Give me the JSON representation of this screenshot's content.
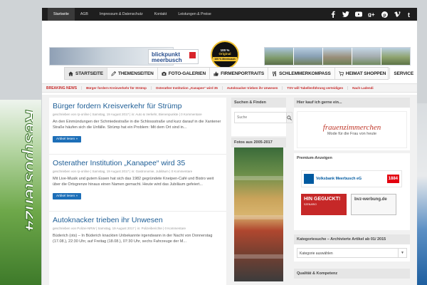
{
  "topnav": [
    {
      "label": "Startseite",
      "active": true
    },
    {
      "label": "AGB",
      "active": false
    },
    {
      "label": "Impressum & Datenschutz",
      "active": false
    },
    {
      "label": "Kontakt",
      "active": false
    },
    {
      "label": "Leistungen & Preise",
      "active": false
    }
  ],
  "social_icons": [
    "facebook-icon",
    "twitter-icon",
    "youtube-icon",
    "googleplus-icon",
    "pinterest-icon",
    "vimeo-icon",
    "tumblr-icon"
  ],
  "header": {
    "logo_line1": "blickpunkt",
    "logo_line2": "meerbusch",
    "seal_top": "100 %",
    "seal_mid": "Original",
    "seal_ribbon": "100 % Meerbusch"
  },
  "mainnav": [
    {
      "label": "Startseite",
      "icon": "home-icon",
      "active": true
    },
    {
      "label": "Themenseiten",
      "icon": "pencil-icon",
      "active": false
    },
    {
      "label": "Foto-Galerien",
      "icon": "camera-icon",
      "active": false
    },
    {
      "label": "Firmenportraits",
      "icon": "thumbs-up-icon",
      "active": false
    },
    {
      "label": "Schlemmerkompass",
      "icon": "cutlery-icon",
      "active": false
    },
    {
      "label": "Heimat shoppen",
      "icon": "cart-icon",
      "active": false
    },
    {
      "label": "Service",
      "icon": "",
      "active": false
    }
  ],
  "breaking": {
    "label": "BREAKING NEWS",
    "items": [
      "Bürger fordern Kreisverkehr für Strümp",
      "Osterather Institution „Kanapee“ wird 35",
      "Autoknacker trieben ihr Unwesen",
      "TSV will Tabellenführung verteidigen",
      "Nach Ladendi"
    ]
  },
  "articles": [
    {
      "title": "Bürger fordern Kreisverkehr für Strümp",
      "meta": "geschrieben von rp-online  |  Samstag, 19 August 2017  |  in: Auto & Verkehr, Bienenpunkte  |  0 Kommentare",
      "excerpt": "An den Einmündungen der Schmiedestraße in die Schlossstraße und kurz darauf in die Xantener Straße häufen sich die Unfälle. Strümp hat ein Problem: Mit dem Ort sind in...",
      "more": "Artikel lesen »"
    },
    {
      "title": "Osterather Institution „Kanapee“ wird 35",
      "meta": "geschrieben von rp-online  |  Samstag, 19 August 2017  |  in: Gastronomie, Jubiläum  |  0 Kommentare",
      "excerpt": "Mit Live-Musik und gutem Essen hat sich das 1982 gegründete Kneipen-Café und Bistro weit über die Ortsgrenze hinaus einen Namen gemacht. Heute wird das Jubiläum gefeiert...",
      "more": "Artikel lesen »"
    },
    {
      "title": "Autoknacker trieben ihr Unwesen",
      "meta": "geschrieben von Polizei-NRW  |  Samstag, 19 August 2017  |  in: Polizeiberichte  |  0 Kommentare",
      "excerpt": "Büderich (ots) – In Büderich knackten Unbekannte irgendwann in der Nacht von Donnerstag (17.08.), 22:30 Uhr, auf Freitag (18.08.), 07:30 Uhr, sechs Fahrzeuge der M...",
      "more": "Artikel lesen »"
    }
  ],
  "sidebar_mid": {
    "search_title": "Suchen & Finden",
    "search_placeholder": "Suche",
    "photos_title": "Fotos aus 2005-2017"
  },
  "sidebar_right": {
    "box1_title": "Hier kauf ich gerne ein...",
    "ad1_big": "frauenzimmerchen",
    "ad1_small": "Mode für die Frau von heute",
    "premium_title": "Premium-Anzeigen",
    "volks_name": "Volksbank Meerbusch eG",
    "volks_year": "1884",
    "hin_text": "HIN GEGUCKT!",
    "hin_sub": "SZENARIO",
    "bvz_text": "bvz-werbung.de",
    "kat_title": "Kategoriesuche – Archivierte Artikel ab 01/ 2015",
    "kat_select": "Kategorie auswählen",
    "qual_title": "Qualität & Kompetenz"
  },
  "left_skin_text": "Restposten24",
  "colors": {
    "accent": "#1d6fb8",
    "breaking": "#c62828",
    "topbar": "#1e1e1e"
  }
}
